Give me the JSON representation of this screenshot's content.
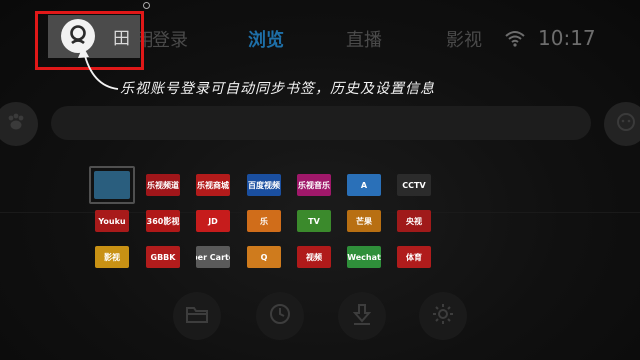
{
  "nav": {
    "partial_tab": "用",
    "login_tab": "登录",
    "tabs": [
      {
        "label": "浏览",
        "active": true
      },
      {
        "label": "直播",
        "active": false
      },
      {
        "label": "影视",
        "active": false
      }
    ],
    "clock": "10:17",
    "login_char": "田"
  },
  "tip": "乐视账号登录可自动同步书签，历史及设置信息",
  "colors": {
    "accent": "#1e6fa8",
    "highlight_border": "#e01818",
    "user_bar": "#4b4b4b"
  },
  "grid": {
    "rows": [
      [
        {
          "label": "",
          "color": "#2a5e7e",
          "selected": true
        },
        {
          "label": "乐视频道",
          "color": "#a0161a"
        },
        {
          "label": "乐视商城",
          "color": "#b31b1b"
        },
        {
          "label": "百度视频",
          "color": "#1a4fa0"
        },
        {
          "label": "乐视音乐",
          "color": "#a0186a"
        },
        {
          "label": "A",
          "color": "#2a70b8"
        },
        {
          "label": "CCTV",
          "color": "#2b2b2b"
        }
      ],
      [
        {
          "label": "Youku",
          "color": "#a81a1a"
        },
        {
          "label": "360影视",
          "color": "#b01818"
        },
        {
          "label": "JD",
          "color": "#c61c1c"
        },
        {
          "label": "乐",
          "color": "#d06d1a"
        },
        {
          "label": "TV",
          "color": "#3b8a2c"
        },
        {
          "label": "芒果",
          "color": "#b86f12"
        },
        {
          "label": "央视",
          "color": "#a01a1a"
        }
      ],
      [
        {
          "label": "影视",
          "color": "#c89114"
        },
        {
          "label": "GBBK",
          "color": "#b21c1c"
        },
        {
          "label": "Super Cartoon",
          "color": "#5a5a5a"
        },
        {
          "label": "Q",
          "color": "#cf7b1d"
        },
        {
          "label": "视频",
          "color": "#b01a1a"
        },
        {
          "label": "Wechat",
          "color": "#2f8f3a"
        },
        {
          "label": "体育",
          "color": "#b01c1c"
        }
      ]
    ]
  },
  "actions": [
    {
      "name": "folder",
      "icon": "folder-icon"
    },
    {
      "name": "history",
      "icon": "clock-icon"
    },
    {
      "name": "download",
      "icon": "download-icon"
    },
    {
      "name": "settings",
      "icon": "gear-icon"
    }
  ]
}
